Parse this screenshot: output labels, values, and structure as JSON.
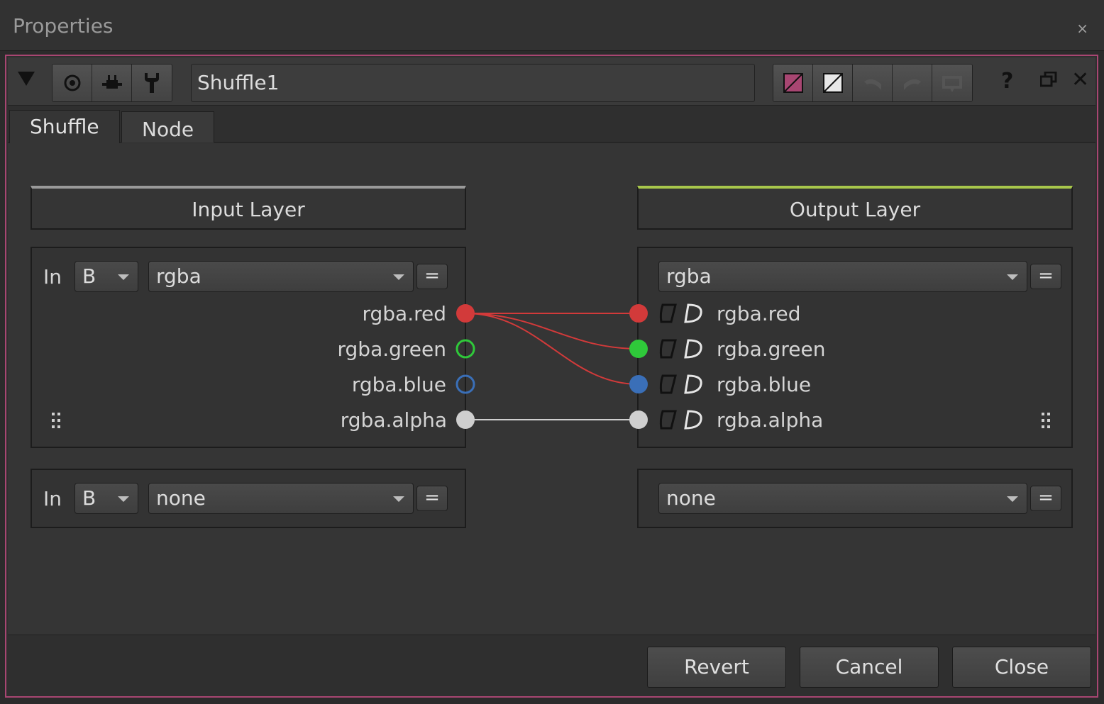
{
  "window": {
    "title": "Properties",
    "close": "×"
  },
  "toolbar": {
    "node_name": "Shuffle1",
    "help": "?",
    "close": "✕"
  },
  "tabs": [
    "Shuffle",
    "Node"
  ],
  "input": {
    "header": "Input Layer",
    "row1": {
      "in_label": "In",
      "input": "B",
      "layer": "rgba",
      "eq": "="
    },
    "channels": [
      "rgba.red",
      "rgba.green",
      "rgba.blue",
      "rgba.alpha"
    ],
    "row2": {
      "in_label": "In",
      "input": "B",
      "layer": "none",
      "eq": "="
    }
  },
  "output": {
    "header": "Output Layer",
    "row1": {
      "layer": "rgba",
      "eq": "="
    },
    "channels": [
      "rgba.red",
      "rgba.green",
      "rgba.blue",
      "rgba.alpha"
    ],
    "row2": {
      "layer": "none",
      "eq": "="
    }
  },
  "connections": [
    {
      "from": "rgba.red",
      "to": "rgba.red"
    },
    {
      "from": "rgba.red",
      "to": "rgba.green"
    },
    {
      "from": "rgba.red",
      "to": "rgba.blue"
    },
    {
      "from": "rgba.alpha",
      "to": "rgba.alpha"
    }
  ],
  "colors": {
    "red": "#d23a3a",
    "green": "#2fc93a",
    "blue": "#3a6fb8",
    "alpha": "#cfcfcf",
    "frame_accent": "#a84672",
    "output_accent": "#a8c74b"
  },
  "footer": {
    "revert": "Revert",
    "cancel": "Cancel",
    "close": "Close"
  }
}
